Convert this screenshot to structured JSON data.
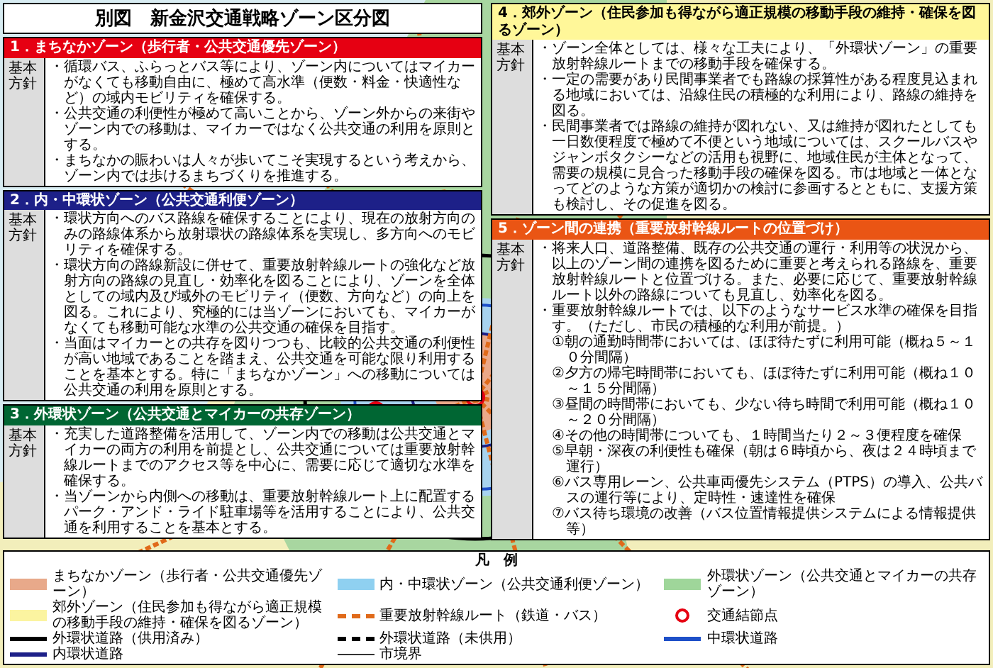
{
  "title": "別図　新金沢交通戦略ゾーン区分図",
  "panels": [
    {
      "heading": "1．まちなかゾーン（歩行者・公共交通優先ゾーン）",
      "color": "#e60012",
      "label": "基本方針",
      "bullets": [
        {
          "text": "・循環バス、ふらっとバス等により、ゾーン内についてはマイカーがなくても移動自由に、極めて高水準（便数・料金・快適性など）の域内モビリティを確保する。"
        },
        {
          "text": "・公共交通の利便性が極めて高いことから、ゾーン外からの来街やゾーン内での移動は、マイカーではなく公共交通の利用を原則とする。"
        },
        {
          "text": "・まちなかの賑わいは人々が歩いてこそ実現するという考えから、ゾーン内では歩けるまちづくりを推進する。"
        }
      ]
    },
    {
      "heading": "2．内・中環状ゾーン（公共交通利便ゾーン）",
      "color": "#1d2088",
      "label": "基本方針",
      "bullets": [
        {
          "text": "・環状方向へのバス路線を確保することにより、現在の放射方向のみの路線体系から放射環状の路線体系を実現し、多方向へのモビリティを確保する。"
        },
        {
          "text": "・環状方向の路線新設に併せて、重要放射幹線ルートの強化など放射方向の路線の見直し・効率化を図ることにより、ゾーンを全体としての域内及び域外のモビリティ（便数、方向など）の向上を図る。これにより、究極的には当ゾーンにおいても、マイカーがなくても移動可能な水準の公共交通の確保を目指す。"
        },
        {
          "text": "・当面はマイカーとの共存を図りつつも、比較的公共交通の利便性が高い地域であることを踏まえ、公共交通を可能な限り利用することを基本とする。特に「まちなかゾーン」への移動については公共交通の利用を原則とする。"
        }
      ]
    },
    {
      "heading": "3．外環状ゾーン（公共交通とマイカーの共存ゾーン）",
      "color": "#006633",
      "label": "基本方針",
      "bullets": [
        {
          "text": "・充実した道路整備を活用して、ゾーン内での移動は公共交通とマイカーの両方の利用を前提とし、公共交通については重要放射幹線ルートまでのアクセス等を中心に、需要に応じて適切な水準を確保する。"
        },
        {
          "text": "・当ゾーンから内側への移動は、重要放射幹線ルート上に配置するパーク・アンド・ライド駐車場等を活用することにより、公共交通を利用することを基本とする。"
        }
      ]
    },
    {
      "heading": "4．郊外ゾーン（住民参加も得ながら適正規模の移動手段の維持・確保を図るゾーン）",
      "color": "#fff799",
      "label": "基本方針",
      "bullets": [
        {
          "text": "・ゾーン全体としては、様々な工夫により、「外環状ゾーン」の重要放射幹線ルートまでの移動手段を確保する。"
        },
        {
          "text": "・一定の需要があり民間事業者でも路線の採算性がある程度見込まれる地域においては、沿線住民の積極的な利用により、路線の維持を図る。"
        },
        {
          "text": "・民間事業者では路線の維持が図れない、又は維持が図れたとしても一日数便程度で極めて不便という地域については、スクールバスやジャンボタクシーなどの活用も視野に、地域住民が主体となって、需要の規模に見合った移動手段の確保を図る。市は地域と一体となってどのような方策が適切かの検討に参画するとともに、支援方策も検討し、その促進を図る。"
        }
      ]
    },
    {
      "heading": "5．ゾーン間の連携（重要放射幹線ルートの位置づけ）",
      "color": "#ea5514",
      "label": "基本方針",
      "bullets": [
        {
          "text": "・将来人口、道路整備、既存の公共交通の運行・利用等の状況から、以上のゾーン間の連携を図るために重要と考えられる路線を、重要放射幹線ルートと位置づける。また、必要に応じて、重要放射幹線ルート以外の路線についても見直し、効率化を図る。"
        },
        {
          "text": "・重要放射幹線ルートでは、以下のようなサービス水準の確保を目指す。（ただし、市民の積極的な利用が前提。）",
          "children": [
            "①朝の通勤時間帯においては、ほぼ待たずに利用可能（概ね５～１０分間隔）",
            "②夕方の帰宅時間帯においても、ほぼ待たずに利用可能（概ね１０～１５分間隔）",
            "③昼間の時間帯においても、少ない待ち時間で利用可能（概ね１０～２０分間隔）",
            "④その他の時間帯についても、１時間当たり２～３便程度を確保",
            "⑤早朝・深夜の利便性も確保（朝は６時頃から、夜は２４時頃まで運行）",
            "⑥バス専用レーン、公共車両優先システム（PTPS）の導入、公共バスの運行等により、定時性・速達性を確保",
            "⑦バス待ち環境の改善（バス位置情報提供システムによる情報提供等）"
          ]
        }
      ]
    }
  ],
  "legend": {
    "title": "凡　例",
    "items": [
      {
        "kind": "area",
        "color": "#e8a98a",
        "label": "まちなかゾーン（歩行者・公共交通優先ゾーン）"
      },
      {
        "kind": "area",
        "color": "#8fd0f0",
        "label": "内・中環状ゾーン（公共交通利便ゾーン）"
      },
      {
        "kind": "area",
        "color": "#9fd69a",
        "label": "外環状ゾーン（公共交通とマイカーの共存ゾーン）"
      },
      {
        "kind": "area",
        "color": "#fbf4a0",
        "label": "郊外ゾーン（住民参加も得ながら適正規模の移動手段の維持・確保を図るゾーン）"
      },
      {
        "kind": "band",
        "color": "#e06a1a",
        "label": "重要放射幹線ルート（鉄道・バス）"
      },
      {
        "kind": "ring",
        "color": "#e60012",
        "label": "交通結節点"
      },
      {
        "kind": "line",
        "color": "#000000",
        "label": "外環状道路（供用済み）"
      },
      {
        "kind": "dashed",
        "color": "#000000",
        "label": "外環状道路（未供用）"
      },
      {
        "kind": "line",
        "color": "#1e50c8",
        "label": "中環状道路"
      },
      {
        "kind": "line",
        "color": "#1d2088",
        "label": "内環状道路"
      },
      {
        "kind": "thin",
        "color": "#333333",
        "label": "市境界"
      }
    ]
  }
}
